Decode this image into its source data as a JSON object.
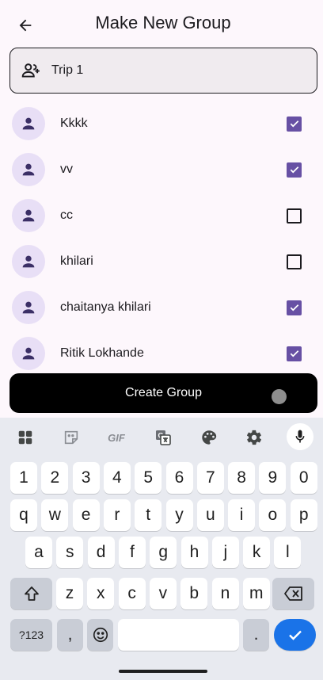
{
  "header": {
    "title": "Make New Group"
  },
  "group_name": {
    "value": "Trip 1"
  },
  "members": [
    {
      "name": "Kkkk",
      "checked": true
    },
    {
      "name": "vv",
      "checked": true
    },
    {
      "name": "cc",
      "checked": false
    },
    {
      "name": "khilari",
      "checked": false
    },
    {
      "name": "chaitanya khilari",
      "checked": true
    },
    {
      "name": "Ritik Lokhande",
      "checked": true
    }
  ],
  "create_button": {
    "label": "Create Group"
  },
  "keyboard": {
    "toolbar": [
      "apps-grid-icon",
      "sticker-icon",
      "gif-icon",
      "translate-icon",
      "palette-icon",
      "gear-icon",
      "mic-icon"
    ],
    "gif_label": "GIF",
    "row_numbers": [
      "1",
      "2",
      "3",
      "4",
      "5",
      "6",
      "7",
      "8",
      "9",
      "0"
    ],
    "row1": [
      "q",
      "w",
      "e",
      "r",
      "t",
      "y",
      "u",
      "i",
      "o",
      "p"
    ],
    "row2": [
      "a",
      "s",
      "d",
      "f",
      "g",
      "h",
      "j",
      "k",
      "l"
    ],
    "row3": [
      "z",
      "x",
      "c",
      "v",
      "b",
      "n",
      "m"
    ],
    "symbols_label": "?123",
    "comma": ",",
    "period": "."
  },
  "colors": {
    "accent": "#6750a4",
    "avatar_bg": "#e8dff6",
    "enter": "#1a73e8"
  }
}
